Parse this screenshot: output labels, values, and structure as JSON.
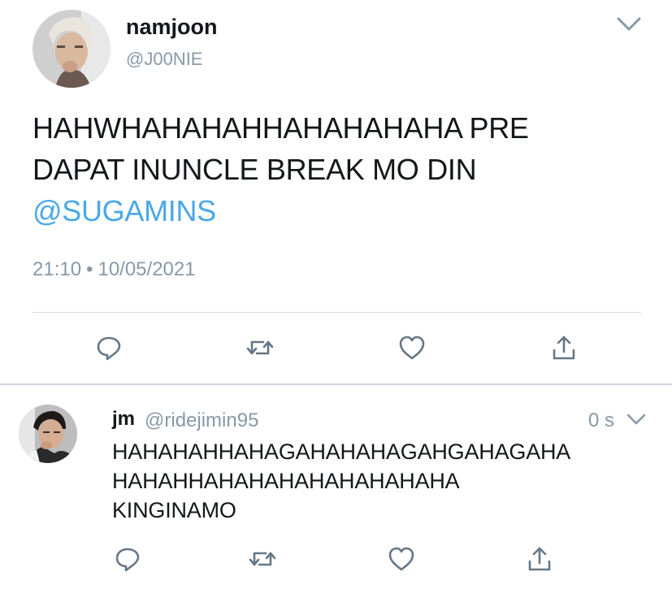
{
  "main_tweet": {
    "display_name": "namjoon",
    "handle": "@J00NIE",
    "text_lines": [
      "HAHWHAHAHAHHAHAHAHAHA PRE",
      "DAPAT INUNCLE BREAK MO DIN"
    ],
    "mention": "@SUGAMINS",
    "time": "21:10",
    "date": "10/05/2021",
    "separator": "•",
    "actions": [
      "reply-icon",
      "retweet-icon",
      "like-icon",
      "share-icon"
    ]
  },
  "reply_tweet": {
    "display_name": "jm",
    "handle": "@ridejimin95",
    "time_ago": "0 s",
    "text_lines": [
      "HAHAHAHHAHAGAHAHAHAGAHGAHAGAHA",
      "HAHAHHAHAHAHAHAHAHAHAHA",
      "KINGINAMO"
    ],
    "actions": [
      "reply-icon",
      "retweet-icon",
      "like-icon",
      "share-icon"
    ]
  },
  "colors": {
    "text": "#14171a",
    "secondary": "#8899a6",
    "mention": "#4aa8e8",
    "icon": "#657786"
  }
}
